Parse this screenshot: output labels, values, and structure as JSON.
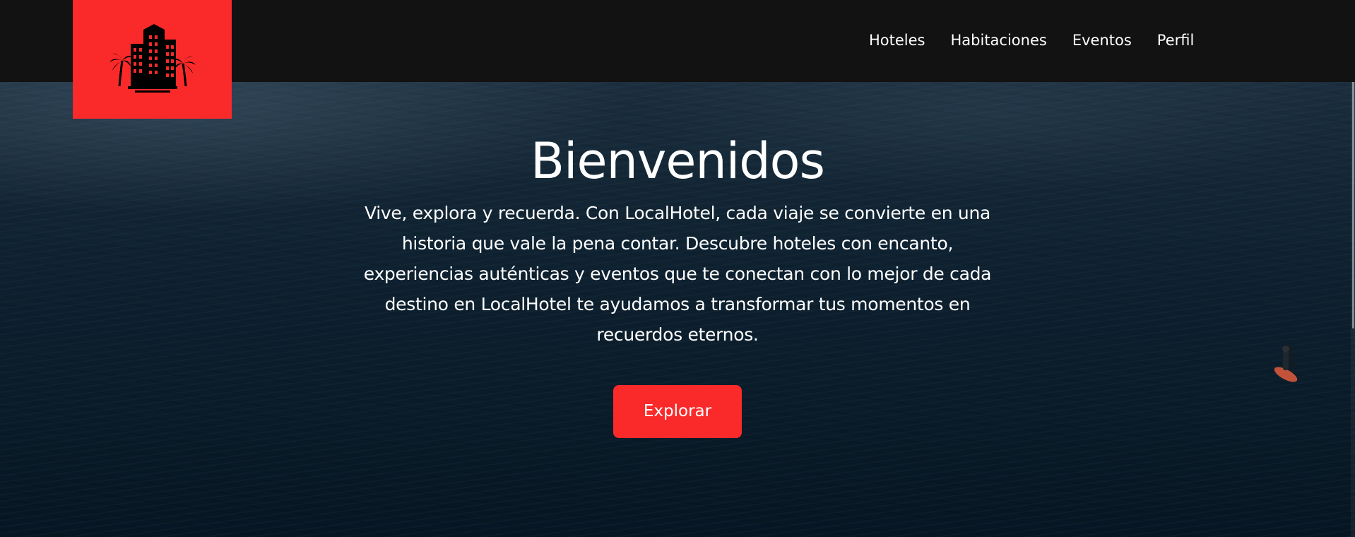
{
  "brand": {
    "name": "LocalHotel",
    "accent_color": "#fb2a2a",
    "logo_icon": "hotel-buildings-palms-icon"
  },
  "nav": {
    "items": [
      {
        "label": "Hoteles"
      },
      {
        "label": "Habitaciones"
      },
      {
        "label": "Eventos"
      },
      {
        "label": "Perfil"
      }
    ]
  },
  "hero": {
    "title": "Bienvenidos",
    "description": "Vive, explora y recuerda. Con LocalHotel, cada viaje se convierte en una historia que vale la pena contar. Descubre hoteles con encanto, experiencias auténticas y eventos que te conectan con lo mejor de cada destino en LocalHotel te ayudamos a transformar tus momentos en recuerdos eternos.",
    "cta_label": "Explorar"
  },
  "colors": {
    "navbar_bg": "#121212",
    "text": "#ffffff"
  }
}
